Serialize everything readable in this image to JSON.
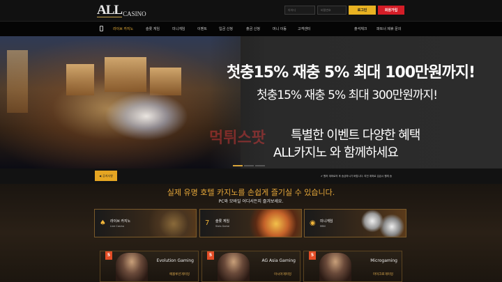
{
  "header": {
    "logo_big": "ALL",
    "logo_small": "CASINO",
    "id_placeholder": "아이디",
    "pw_placeholder": "비밀번호",
    "login_label": "로그인",
    "join_label": "회원가입"
  },
  "nav": {
    "items": [
      {
        "label": "라이브 카지노",
        "active": true
      },
      {
        "label": "슬롯 게임"
      },
      {
        "label": "미니게임"
      },
      {
        "label": "이벤트"
      },
      {
        "label": "입금 신청"
      },
      {
        "label": "출금 신청"
      },
      {
        "label": "머니 이동"
      },
      {
        "label": "고객센터"
      },
      {
        "label": "출석체크"
      },
      {
        "label": "파트너 제휴 문의"
      }
    ]
  },
  "hero": {
    "line1": "첫충15% 재충 5% 최대 100만원까지!",
    "line2": "첫충15% 재충 5% 최대 300만원까지!",
    "line3": "특별한 이벤트 다양한 혜택",
    "line4": "ALL카지노 와 함께하세요",
    "watermark": "먹튀스팟"
  },
  "notice": {
    "badge": "공지사항",
    "text": "✔ 원하 계좌로의 후 송금하시기 바랍니다. 여전 계좌로 입금시 원래 송"
  },
  "main": {
    "title": "실제 유명 호텔 카지노를 손쉽게 즐기실 수 있습니다.",
    "subtitle": "PC와 모바일 어디서든지 즐겨보세요.",
    "cards": [
      {
        "icon": "♠",
        "title": "라이브 카지노",
        "subtitle": "Live Casino"
      },
      {
        "icon": "7",
        "title": "슬롯 게임",
        "subtitle": "Slots Game"
      },
      {
        "icon": "◉",
        "title": "미니게임",
        "subtitle": "MINI"
      }
    ],
    "providers": [
      {
        "logo": "Evolution Gaming",
        "name": "에볼루션게이밍"
      },
      {
        "logo": "AG Asia Gaming",
        "name": "아시아게이밍"
      },
      {
        "logo": "Microgaming",
        "name": "마이크로게이밍"
      }
    ]
  },
  "colors": {
    "accent": "#e8b222",
    "join": "#d41d27",
    "active_nav": "#f2b63a"
  }
}
